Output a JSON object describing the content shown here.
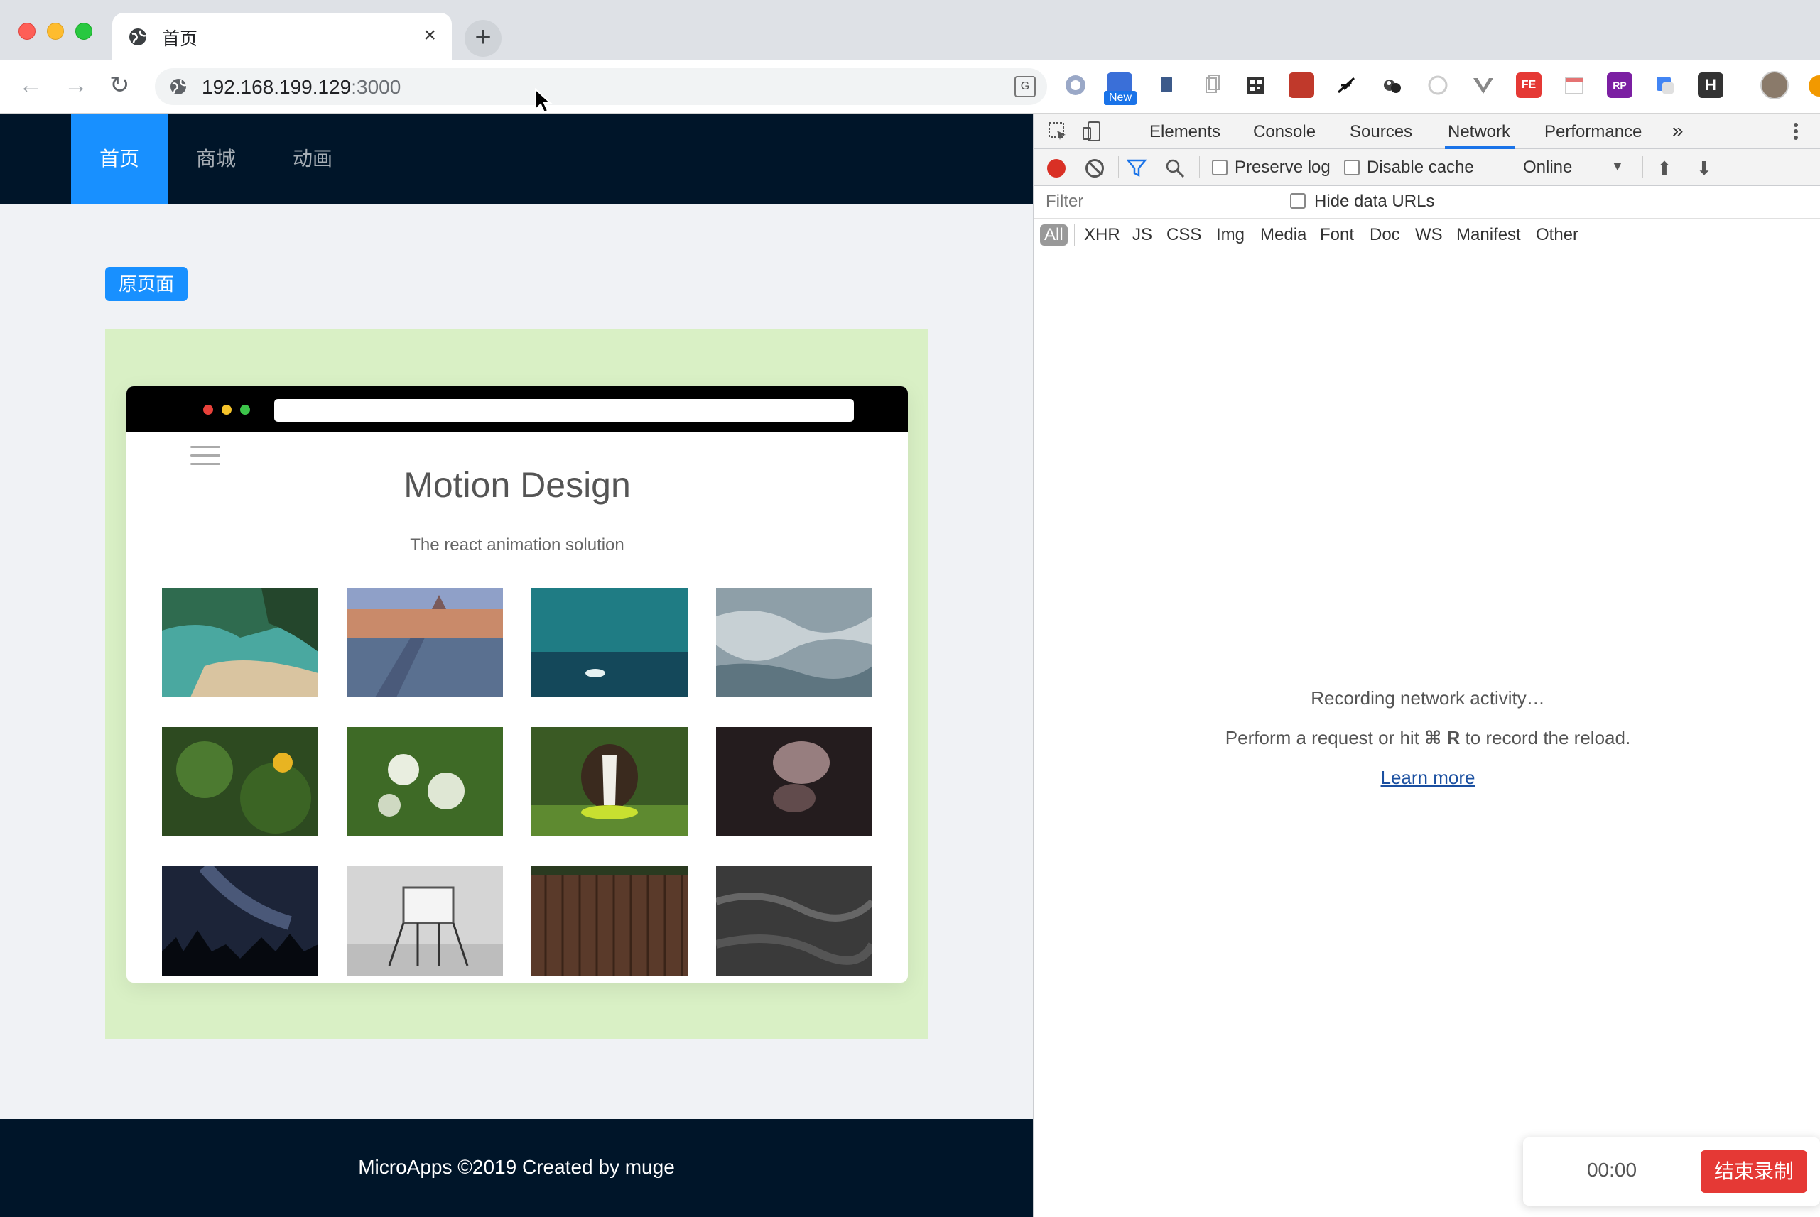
{
  "browser": {
    "tab_title": "首页",
    "tab_close": "×",
    "new_tab": "+",
    "url_host": "192.168.199.129",
    "url_port": ":3000",
    "back": "←",
    "forward": "→",
    "reload": "↻",
    "ext_new_badge": "New",
    "ext_fe_label": "FE",
    "ext_rp_label": "RP",
    "ext_h_label": "H"
  },
  "site": {
    "menu": [
      {
        "label": "首页",
        "active": true
      },
      {
        "label": "商城",
        "active": false
      },
      {
        "label": "动画",
        "active": false
      }
    ],
    "original_page_button": "原页面",
    "demo": {
      "title": "Motion Design",
      "subtitle": "The react animation solution"
    },
    "footer": "MicroApps ©2019 Created by muge"
  },
  "devtools": {
    "tabs": [
      "Elements",
      "Console",
      "Sources",
      "Network",
      "Performance"
    ],
    "more_tabs": "»",
    "active_tab": "Network",
    "preserve_log": "Preserve log",
    "disable_cache": "Disable cache",
    "throttling": "Online",
    "filter_placeholder": "Filter",
    "hide_data_urls": "Hide data URLs",
    "types": [
      "All",
      "XHR",
      "JS",
      "CSS",
      "Img",
      "Media",
      "Font",
      "Doc",
      "WS",
      "Manifest",
      "Other"
    ],
    "empty": {
      "line1": "Recording network activity…",
      "line2_pre": "Perform a request or hit ",
      "line2_key": "⌘ R",
      "line2_post": " to record the reload.",
      "learn_more": "Learn more"
    }
  },
  "recorder": {
    "time": "00:00",
    "stop_label": "结束录制"
  },
  "colors": {
    "header_bg": "#001529",
    "accent": "#1890ff",
    "panel_green": "#d9f0c5",
    "record_red": "#d93025",
    "stop_red": "#e53935"
  }
}
